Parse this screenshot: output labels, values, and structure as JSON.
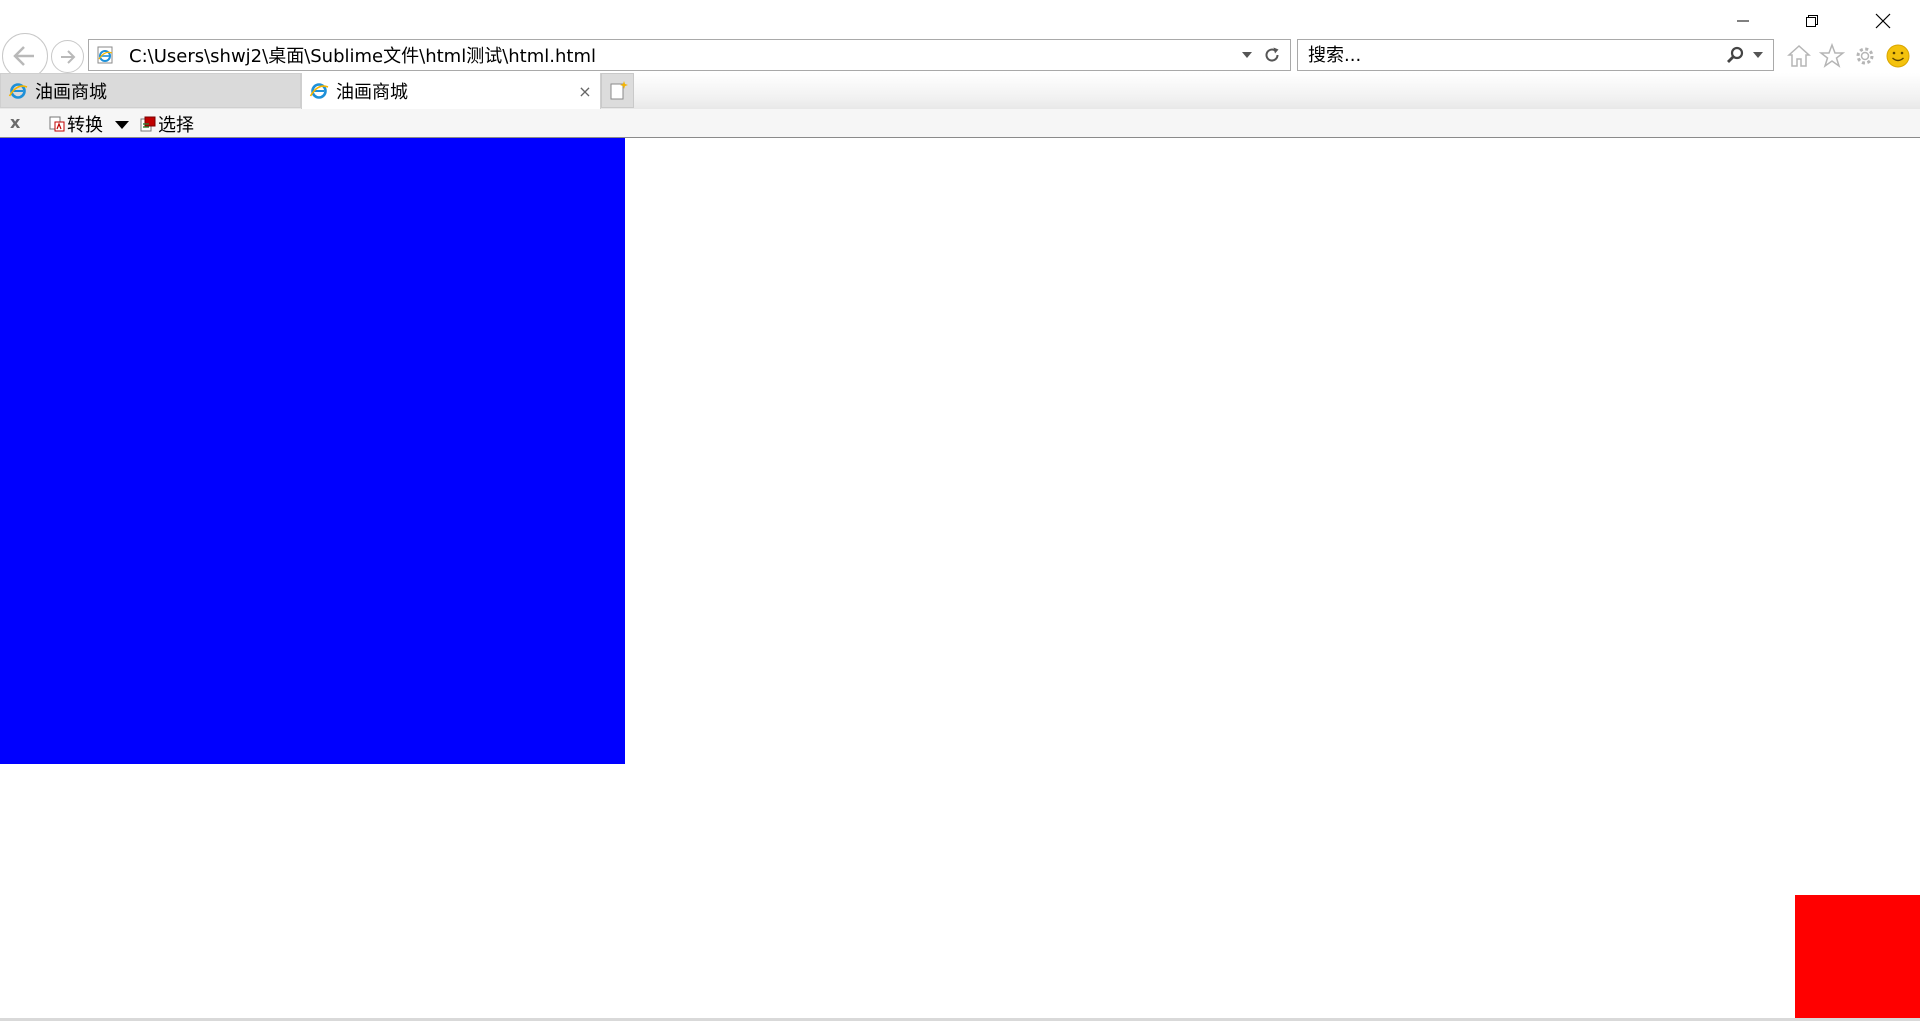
{
  "window": {
    "controls": [
      "minimize",
      "restore",
      "close"
    ]
  },
  "address_bar": {
    "url": "C:\\Users\\shwj2\\桌面\\Sublime文件\\html测试\\html.html"
  },
  "search": {
    "placeholder": "搜索..."
  },
  "tabs": [
    {
      "title": "油画商城",
      "active": false
    },
    {
      "title": "油画商城",
      "active": true,
      "close_label": "×"
    }
  ],
  "toolbar": {
    "close_label": "x",
    "convert_label": "转换",
    "select_label": "选择"
  },
  "icons": {
    "back": "back-arrow-icon",
    "forward": "forward-arrow-icon",
    "page": "ie-page-icon",
    "refresh": "refresh-icon",
    "search": "search-icon",
    "home": "home-icon",
    "favorites": "star-icon",
    "settings": "gear-icon",
    "feedback": "smiley-icon",
    "new_tab": "new-tab-icon"
  },
  "page_content": {
    "blue_box_color": "#0000ff",
    "red_box_color": "#ff0000"
  },
  "colors": {
    "ie_blue": "#1e90d8",
    "ie_gold": "#f4b400",
    "feedback_yellow": "#f4c20d"
  }
}
